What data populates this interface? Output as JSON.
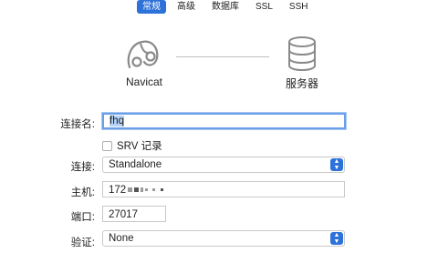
{
  "tabs": [
    {
      "label": "常规",
      "active": true
    },
    {
      "label": "高级"
    },
    {
      "label": "数据库"
    },
    {
      "label": "SSL"
    },
    {
      "label": "SSH"
    }
  ],
  "diagram": {
    "client_label": "Navicat",
    "server_label": "服务器",
    "client_icon": "navicat-dolphin-icon",
    "server_icon": "database-icon"
  },
  "form": {
    "connection_name": {
      "label": "连接名:",
      "value": "fhq"
    },
    "srv_record": {
      "label": "SRV 记录",
      "checked": false
    },
    "connection_type": {
      "label": "连接:",
      "value": "Standalone"
    },
    "host": {
      "label": "主机:",
      "value_visible": "172"
    },
    "port": {
      "label": "端口:",
      "value": "27017"
    },
    "auth": {
      "label": "验证:",
      "value": "None"
    }
  },
  "colors": {
    "accent": "#2d72d9",
    "focus": "#6aa0e8"
  }
}
